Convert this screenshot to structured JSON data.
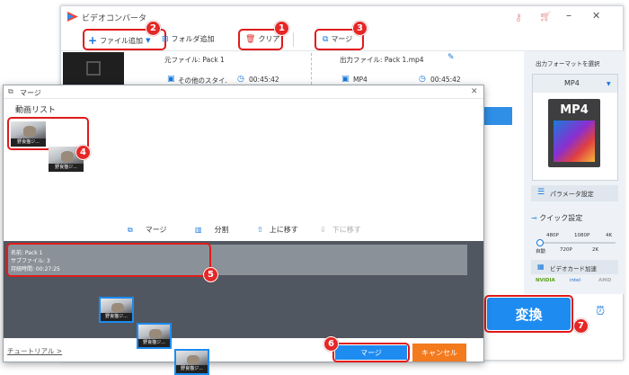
{
  "app": {
    "title": "ビデオコンバータ"
  },
  "toolbar": {
    "add_file": "ファイル追加",
    "add_folder": "フォルダ追加",
    "clear": "クリア",
    "merge": "マージ"
  },
  "file_row": {
    "source": "元ファイル: Pack 1",
    "output": "出力ファイル: Pack 1.mp4",
    "style": "その他のスタイ.",
    "duration1": "00:45:42",
    "format": "MP4",
    "duration2": "00:45:42"
  },
  "right_panel": {
    "title": "出力フォーマットを選択",
    "format": "MP4",
    "icon_text": "MP4",
    "param": "パラメータ設定",
    "quick": "クイック設定",
    "res_top": [
      "480P",
      "1080P",
      "4K"
    ],
    "res_bottom": [
      "自動",
      "720P",
      "2K"
    ],
    "gpu": "ビデオカード加速",
    "vendors": [
      "NVIDIA",
      "intel",
      "AMD"
    ],
    "convert": "変換"
  },
  "dialog": {
    "title": "マージ",
    "list_label": "動画リスト",
    "thumb_label": "野良猫ジ...",
    "tool_merge": "マージ",
    "tool_split": "分割",
    "tool_up": "上に移す",
    "tool_down": "下に移す",
    "pack": {
      "name": "名前: Pack 1",
      "sub": "サブファイル: 3",
      "time": "持続時間: 00:27:25"
    },
    "tutorial": "チュートリアル >",
    "ok": "マージ",
    "cancel": "キャンセル"
  },
  "badges": [
    "1",
    "2",
    "3",
    "4",
    "5",
    "6",
    "7"
  ],
  "colors": {
    "accent": "#1e8bf0",
    "badge": "#e52727",
    "cancel": "#f47a1e"
  }
}
